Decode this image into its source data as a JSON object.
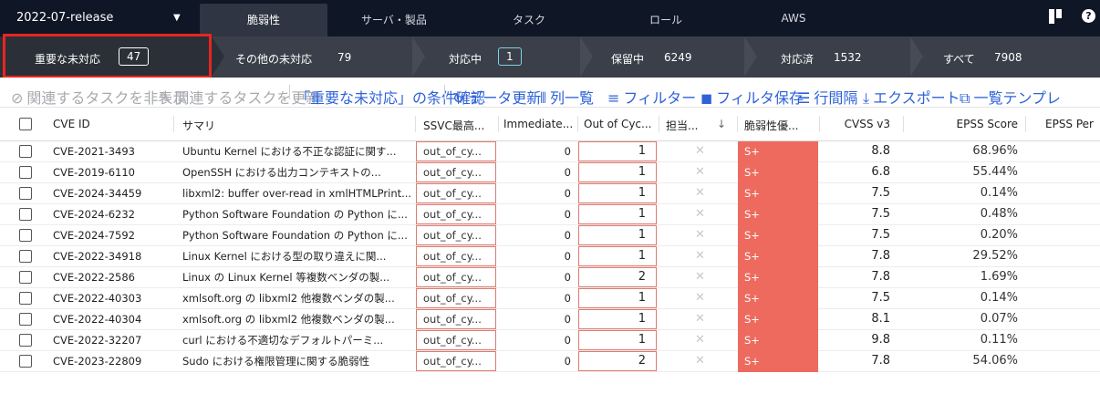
{
  "topnav": {
    "release": "2022-07-release",
    "tabs": [
      "脆弱性",
      "サーバ・製品",
      "タスク",
      "ロール",
      "AWS"
    ],
    "active_tab": 0,
    "help_glyph": "?",
    "icons": [
      "bookmark-icon",
      "help-icon"
    ]
  },
  "status": {
    "segments": [
      {
        "label": "重要な未対応",
        "count": "47"
      },
      {
        "label": "その他の未対応",
        "count": "79"
      },
      {
        "label": "対応中",
        "count": "1"
      },
      {
        "label": "保留中",
        "count": "6249"
      },
      {
        "label": "対応済",
        "count": "1532"
      },
      {
        "label": "すべて",
        "count": "7908"
      }
    ]
  },
  "toolbar": {
    "hide_related": "関連するタスクを非表示",
    "update_related": "関連するタスクを更新",
    "check_conditions": "「重要な未対応」の条件確認",
    "refresh": "データ更新",
    "columns": "列一覧",
    "filter": "フィルター",
    "save_filter": "フィルタ保存",
    "row_spacing": "行間隔",
    "export": "エクスポート",
    "template": "一覧テンプレ"
  },
  "table": {
    "headers": [
      "CVE ID",
      "サマリ",
      "SSVC最高...",
      "Immediate...",
      "Out of Cyc...",
      "担当...",
      "脆弱性優...",
      "CVSS v3",
      "EPSS Score",
      "EPSS Per"
    ],
    "rows": [
      {
        "cve": "CVE-2021-3493",
        "summary": "Ubuntu Kernel における不正な認証に関す...",
        "ssvc": "out_of_cy...",
        "immediate": "0",
        "ooc": "1",
        "severity": "S+",
        "cvss": "8.8",
        "epss": "68.96%"
      },
      {
        "cve": "CVE-2019-6110",
        "summary": "OpenSSH における出力コンテキストの...",
        "ssvc": "out_of_cy...",
        "immediate": "0",
        "ooc": "1",
        "severity": "S+",
        "cvss": "6.8",
        "epss": "55.44%"
      },
      {
        "cve": "CVE-2024-34459",
        "summary": "libxml2: buffer over-read in xmlHTMLPrint...",
        "ssvc": "out_of_cy...",
        "immediate": "0",
        "ooc": "1",
        "severity": "S+",
        "cvss": "7.5",
        "epss": "0.14%"
      },
      {
        "cve": "CVE-2024-6232",
        "summary": "Python Software Foundation の Python に...",
        "ssvc": "out_of_cy...",
        "immediate": "0",
        "ooc": "1",
        "severity": "S+",
        "cvss": "7.5",
        "epss": "0.48%"
      },
      {
        "cve": "CVE-2024-7592",
        "summary": "Python Software Foundation の Python に...",
        "ssvc": "out_of_cy...",
        "immediate": "0",
        "ooc": "1",
        "severity": "S+",
        "cvss": "7.5",
        "epss": "0.20%"
      },
      {
        "cve": "CVE-2022-34918",
        "summary": "Linux Kernel における型の取り違えに関...",
        "ssvc": "out_of_cy...",
        "immediate": "0",
        "ooc": "1",
        "severity": "S+",
        "cvss": "7.8",
        "epss": "29.52%"
      },
      {
        "cve": "CVE-2022-2586",
        "summary": "Linux の Linux Kernel 等複数ベンダの製...",
        "ssvc": "out_of_cy...",
        "immediate": "0",
        "ooc": "2",
        "severity": "S+",
        "cvss": "7.8",
        "epss": "1.69%"
      },
      {
        "cve": "CVE-2022-40303",
        "summary": "xmlsoft.org の libxml2 他複数ベンダの製...",
        "ssvc": "out_of_cy...",
        "immediate": "0",
        "ooc": "1",
        "severity": "S+",
        "cvss": "7.5",
        "epss": "0.14%"
      },
      {
        "cve": "CVE-2022-40304",
        "summary": "xmlsoft.org の libxml2 他複数ベンダの製...",
        "ssvc": "out_of_cy...",
        "immediate": "0",
        "ooc": "1",
        "severity": "S+",
        "cvss": "8.1",
        "epss": "0.07%"
      },
      {
        "cve": "CVE-2022-32207",
        "summary": "curl における不適切なデフォルトパーミ...",
        "ssvc": "out_of_cy...",
        "immediate": "0",
        "ooc": "1",
        "severity": "S+",
        "cvss": "9.8",
        "epss": "0.11%"
      },
      {
        "cve": "CVE-2023-22809",
        "summary": "Sudo における権限管理に関する脆弱性",
        "ssvc": "out_of_cy...",
        "immediate": "0",
        "ooc": "2",
        "severity": "S+",
        "cvss": "7.8",
        "epss": "54.06%"
      }
    ]
  },
  "colors": {
    "nav_bg": "#0f1626",
    "status_bg": "#3a3f49",
    "highlight_frame": "#e8261f",
    "severity_bg": "#ee6a5f",
    "link_blue": "#2f62d9"
  }
}
